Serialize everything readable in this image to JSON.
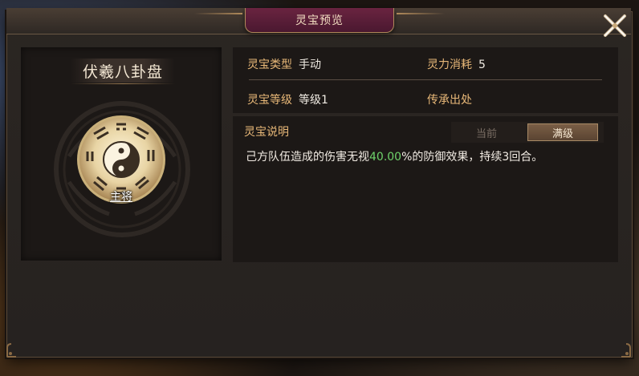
{
  "dialog": {
    "title": "灵宝预览",
    "close_icon": "close-x-icon"
  },
  "treasure": {
    "name": "伏羲八卦盘",
    "role": "主将",
    "icon": "bagua-yin-yang-icon"
  },
  "info": {
    "type_label": "灵宝类型",
    "type_value": "手动",
    "cost_label": "灵力消耗",
    "cost_value": "5",
    "level_label": "灵宝等级",
    "level_value": "等级1",
    "source_label": "传承出处"
  },
  "description": {
    "title": "灵宝说明",
    "tabs": {
      "current": "当前",
      "max": "满级",
      "active": "max"
    },
    "text_before": "己方队伍造成的伤害无视",
    "highlight": "40.00",
    "text_after": "%的防御效果，持续3回合。"
  },
  "colors": {
    "accent_label": "#e8b878",
    "highlight_green": "#6ed26a",
    "title_plate": "#6a2440"
  }
}
